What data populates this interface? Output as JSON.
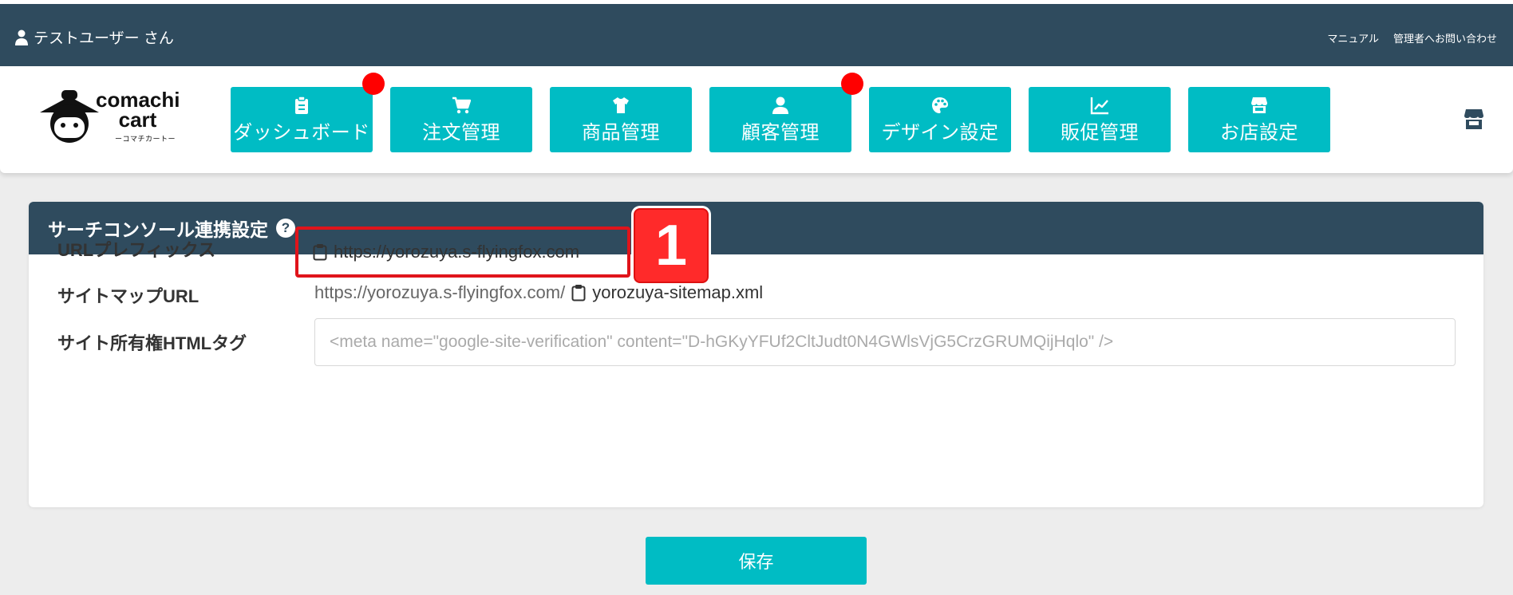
{
  "header": {
    "user_label": "テストユーザー さん",
    "links": [
      "マニュアル",
      "管理者へお問い合わせ"
    ]
  },
  "logo": {
    "brand_line1": "comachi",
    "brand_line2": "cart",
    "sub": "ーコマチカートー"
  },
  "nav": {
    "items": [
      {
        "label": "ダッシュボード",
        "icon": "clipboard-icon",
        "has_badge": true
      },
      {
        "label": "注文管理",
        "icon": "cart-icon",
        "has_badge": false
      },
      {
        "label": "商品管理",
        "icon": "shirt-icon",
        "has_badge": false
      },
      {
        "label": "顧客管理",
        "icon": "user-icon",
        "has_badge": true
      },
      {
        "label": "デザイン設定",
        "icon": "palette-icon",
        "has_badge": false
      },
      {
        "label": "販促管理",
        "icon": "chart-line-icon",
        "has_badge": false
      },
      {
        "label": "お店設定",
        "icon": "store-icon",
        "has_badge": false
      }
    ],
    "right_icon": "store-icon"
  },
  "panel": {
    "title": "サーチコンソール連携設定",
    "help_glyph": "?",
    "url_prefix_label": "URLプレフィックス",
    "url_prefix_value": "https://yorozuya.s-flyingfox.com",
    "step_number": "1",
    "sitemap_label": "サイトマップURL",
    "sitemap_base": "https://yorozuya.s-flyingfox.com/",
    "sitemap_file": "yorozuya-sitemap.xml",
    "html_tag_label": "サイト所有権HTMLタグ",
    "html_tag_placeholder": "<meta name=\"google-site-verification\" content=\"D-hGKyYFUf2CltJudt0N4GWlsVjG5CrzGRUMQijHqlo\" />"
  },
  "save_label": "保存",
  "colors": {
    "header_bg": "#2f4b5e",
    "accent": "#00bcc4",
    "badge": "#ff0000",
    "highlight": "#e0141b"
  }
}
